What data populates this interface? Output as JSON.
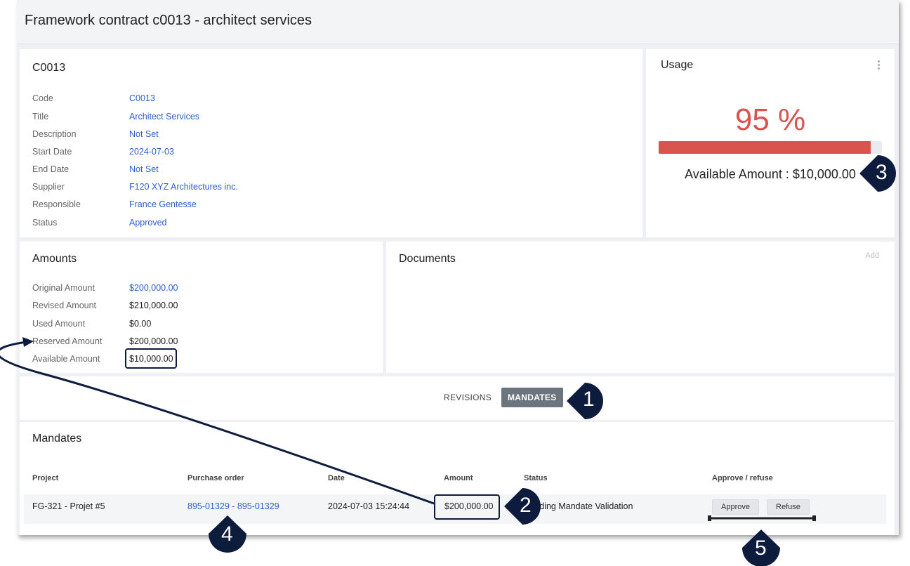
{
  "header": {
    "title": "Framework contract c0013 - architect services"
  },
  "details": {
    "title": "C0013",
    "fields": [
      {
        "label": "Code",
        "value": "C0013"
      },
      {
        "label": "Title",
        "value": "Architect Services"
      },
      {
        "label": "Description",
        "value": "Not Set"
      },
      {
        "label": "Start Date",
        "value": "2024-07-03"
      },
      {
        "label": "End Date",
        "value": "Not Set"
      },
      {
        "label": "Supplier",
        "value": "F120 XYZ Architectures inc."
      },
      {
        "label": "Responsible",
        "value": "France Gentesse"
      },
      {
        "label": "Status",
        "value": "Approved"
      }
    ]
  },
  "usage": {
    "title": "Usage",
    "percent_text": "95 %",
    "percent_value": 0.95,
    "available_text": "Available Amount : $10,000.00",
    "bar_color": "#d9534f"
  },
  "amounts": {
    "title": "Amounts",
    "fields": [
      {
        "label": "Original Amount",
        "value": "$200,000.00"
      },
      {
        "label": "Revised Amount",
        "value": "$210,000.00"
      },
      {
        "label": "Used Amount",
        "value": "$0.00"
      },
      {
        "label": "Reserved Amount",
        "value": "$200,000.00"
      },
      {
        "label": "Available Amount",
        "value": "$10,000.00"
      }
    ]
  },
  "documents": {
    "title": "Documents",
    "add_label": "Add"
  },
  "tabs": {
    "revisions": "REVISIONS",
    "mandates": "MANDATES"
  },
  "mandates": {
    "title": "Mandates",
    "columns": [
      "Project",
      "Purchase order",
      "Date",
      "Amount",
      "Status",
      "Approve / refuse"
    ],
    "row": {
      "project": "FG-321 - Projet #5",
      "purchase_order": "895-01329 - 895-01329",
      "date": "2024-07-03 15:24:44",
      "amount": "$200,000.00",
      "status": "Pending Mandate Validation",
      "approve_label": "Approve",
      "refuse_label": "Refuse"
    }
  },
  "callouts": [
    "1",
    "2",
    "3",
    "4",
    "5"
  ],
  "colors": {
    "accent_link": "#2f5fd0",
    "danger": "#d9534f",
    "callout": "#0d1b3d",
    "tab_active": "#6c757d"
  }
}
